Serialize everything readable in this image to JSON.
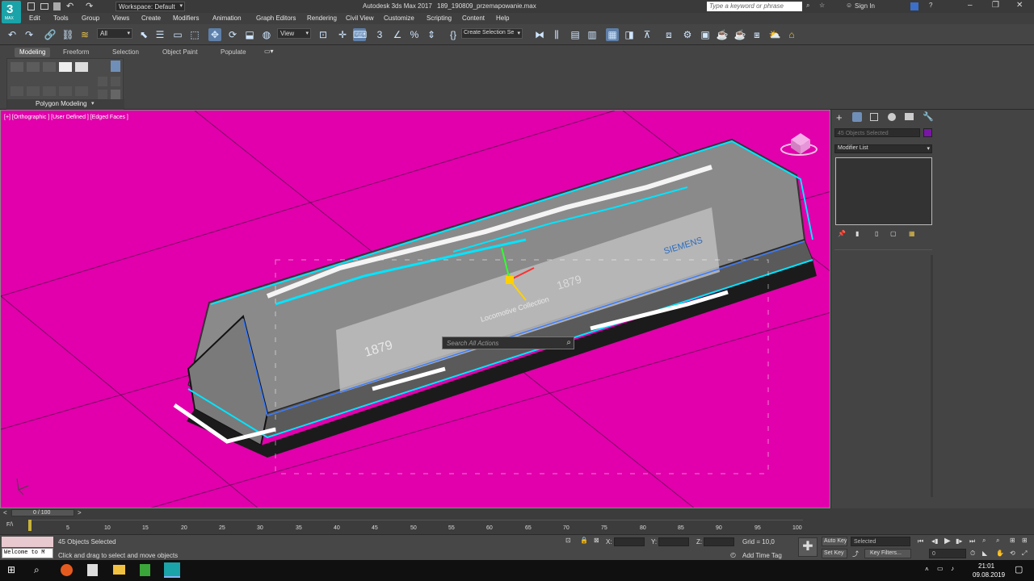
{
  "app": {
    "title": "Autodesk 3ds Max 2017",
    "filename": "189_190809_przemapowanie.max",
    "workspace": "Workspace: Default",
    "search_placeholder": "Type a keyword or phrase",
    "sign_in": "Sign In",
    "logo_label": "3",
    "logo_sub": "MAX"
  },
  "menu": [
    "Edit",
    "Tools",
    "Group",
    "Views",
    "Create",
    "Modifiers",
    "Animation",
    "Graph Editors",
    "Rendering",
    "Civil View",
    "Customize",
    "Scripting",
    "Content",
    "Help"
  ],
  "toolbar": {
    "filter": "All",
    "coord_system": "View",
    "selection_set": "Create Selection Se"
  },
  "ribbon": {
    "tabs": [
      "Modeling",
      "Freeform",
      "Selection",
      "Object Paint",
      "Populate"
    ],
    "panel_label": "Polygon Modeling"
  },
  "viewport": {
    "label": "[+] [Orthographic ] [User Defined ] [Edged Faces ]",
    "search_placeholder": "Search All Actions",
    "model_text": {
      "brand": "SIEMENS",
      "year1": "1879",
      "year2": "1879",
      "badge": "Locomotive Collection"
    }
  },
  "command_panel": {
    "selection": "45 Objects Selected",
    "modifier_list": "Modifier List",
    "color_swatch": "#7a16a6"
  },
  "timeline": {
    "frame": "0 / 100",
    "ticks": [
      "0",
      "5",
      "10",
      "15",
      "20",
      "25",
      "30",
      "35",
      "40",
      "45",
      "50",
      "55",
      "60",
      "65",
      "70",
      "75",
      "80",
      "85",
      "90",
      "95",
      "100"
    ]
  },
  "status": {
    "listener": "Welcome to M",
    "objects": "45 Objects Selected",
    "prompt": "Click and drag to select and move objects",
    "x_label": "X:",
    "y_label": "Y:",
    "z_label": "Z:",
    "grid": "Grid = 10,0",
    "add_time_tag": "Add Time Tag",
    "auto_key": "Auto Key",
    "set_key": "Set Key",
    "key_mode": "Selected",
    "key_filters": "Key Filters...",
    "frame_value": "0"
  },
  "taskbar": {
    "time": "21:01",
    "date": "09.08.2019"
  },
  "colors": {
    "viewport_bg": "#e100ab",
    "wire": "#00e5ff",
    "logo": "#1aa3a8"
  }
}
